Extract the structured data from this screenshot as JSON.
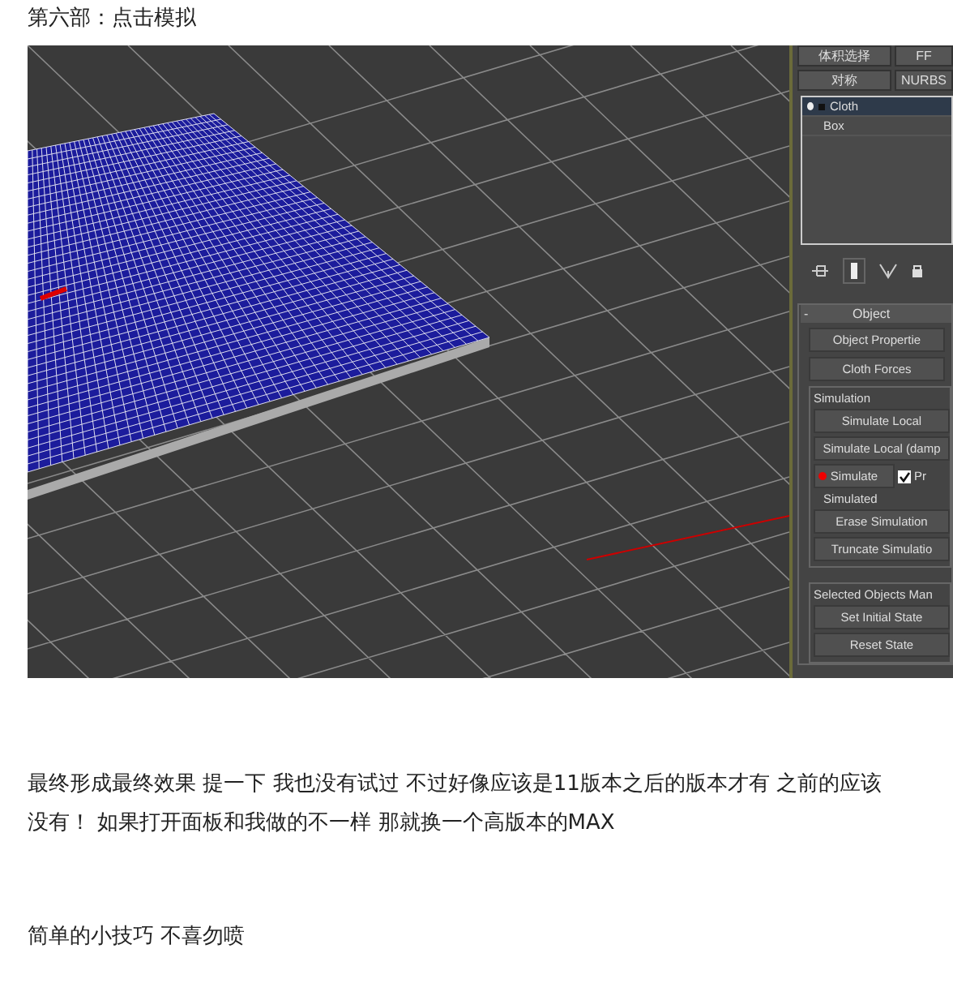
{
  "heading": "第六部：点击模拟",
  "panel": {
    "modifier_buttons": [
      {
        "label": "体积选择"
      },
      {
        "label": "FF"
      },
      {
        "label": "对称"
      },
      {
        "label": "NURBS"
      }
    ],
    "stack": [
      {
        "label": "Cloth",
        "selected": true
      },
      {
        "label": "Box",
        "selected": false
      }
    ],
    "rollout": {
      "collapse": "-",
      "title": "Object",
      "buttons": [
        {
          "label": "Object Propertie"
        },
        {
          "label": "Cloth Forces"
        }
      ],
      "simulation": {
        "title": "Simulation",
        "items": [
          {
            "kind": "button",
            "label": "Simulate Local"
          },
          {
            "kind": "button",
            "label": "Simulate Local (damp"
          },
          {
            "kind": "button-check",
            "label": "Simulate",
            "check_label": "Pr",
            "checked": true
          },
          {
            "kind": "label",
            "label": "Simulated"
          },
          {
            "kind": "button",
            "label": "Erase Simulation"
          },
          {
            "kind": "button",
            "label": "Truncate Simulatio"
          }
        ]
      },
      "selected_group": {
        "title": "Selected Objects Man",
        "buttons": [
          {
            "label": "Set Initial State"
          },
          {
            "label": "Reset State"
          }
        ]
      }
    }
  },
  "paragraphs": [
    "最终形成最终效果 提一下 我也没有试过 不过好像应该是11版本之后的版本才有 之前的应该没有！ 如果打开面板和我做的不一样 那就换一个高版本的MAX",
    "简单的小技巧 不喜勿喷"
  ]
}
